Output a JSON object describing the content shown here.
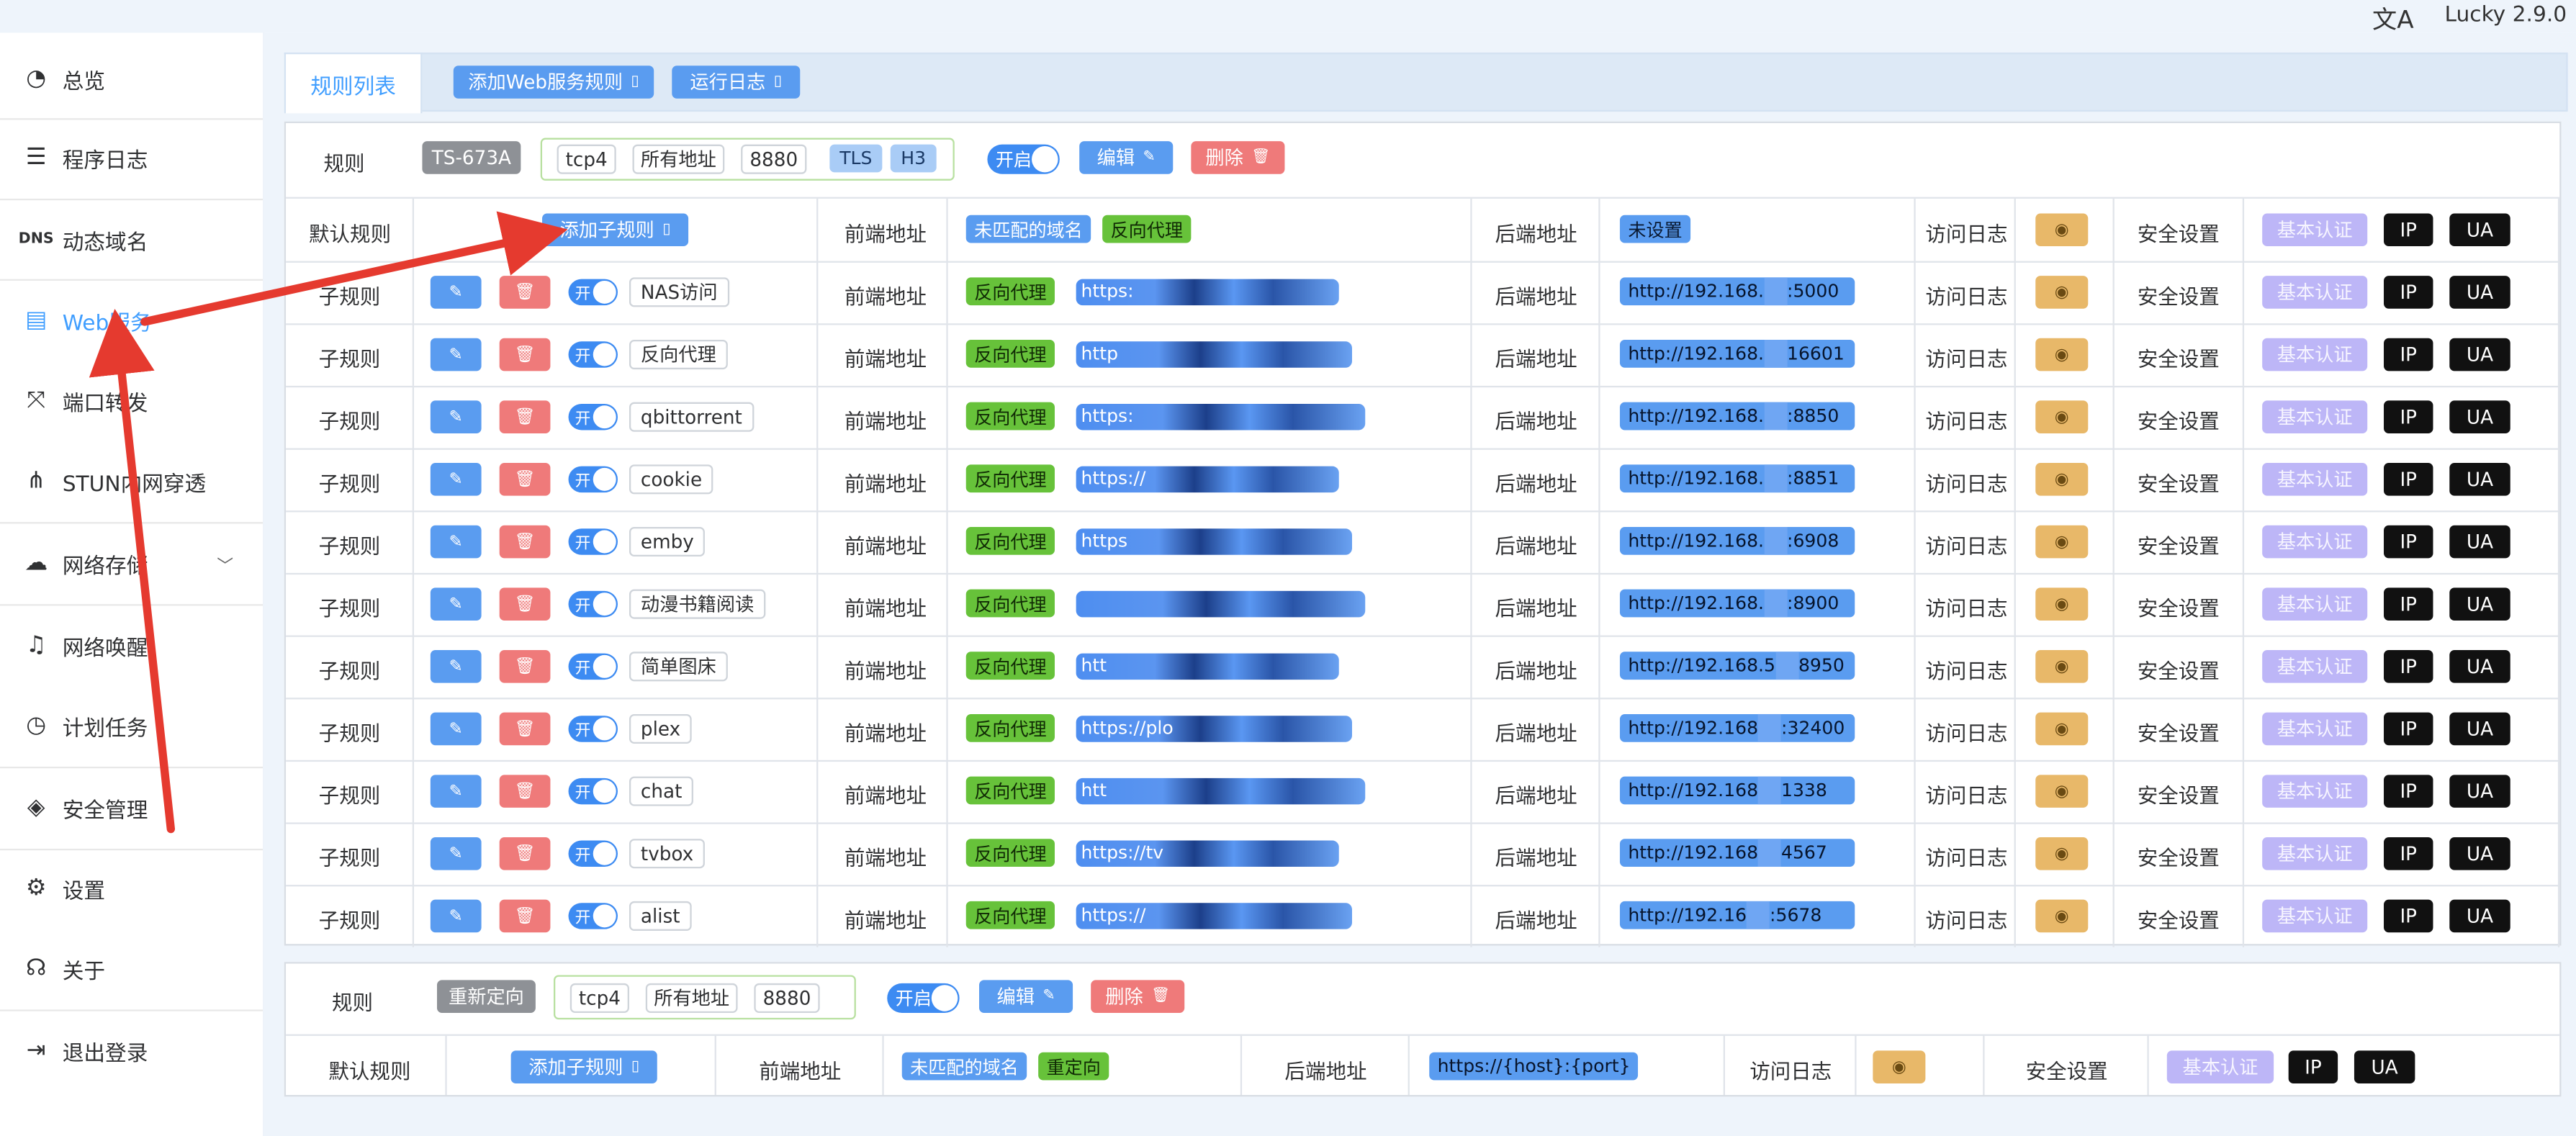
{
  "app": {
    "version": "Lucky 2.9.0",
    "lang_icon": "文A"
  },
  "sidebar": {
    "items": [
      {
        "label": "总览",
        "icon": "dashboard-icon"
      },
      {
        "label": "程序日志",
        "icon": "log-icon"
      },
      {
        "label": "动态域名",
        "icon": "dns-icon"
      },
      {
        "label": "Web服务",
        "icon": "web-service-icon"
      },
      {
        "label": "端口转发",
        "icon": "port-forward-icon"
      },
      {
        "label": "STUN内网穿透",
        "icon": "stun-icon"
      },
      {
        "label": "网络存储",
        "icon": "cloud-storage-icon"
      },
      {
        "label": "网络唤醒",
        "icon": "bell-icon"
      },
      {
        "label": "计划任务",
        "icon": "clock-icon"
      },
      {
        "label": "安全管理",
        "icon": "shield-icon"
      },
      {
        "label": "设置",
        "icon": "gear-icon"
      },
      {
        "label": "关于",
        "icon": "about-icon"
      },
      {
        "label": "退出登录",
        "icon": "logout-icon"
      }
    ],
    "active_index": 3
  },
  "tabs": {
    "rule_list": "规则列表",
    "add_web_rule": "添加Web服务规则",
    "run_log": "运行日志"
  },
  "common": {
    "rule": "规则",
    "default_rule": "默认规则",
    "sub_rule": "子规则",
    "add_sub_rule": "添加子规则",
    "frontend": "前端地址",
    "backend": "后端地址",
    "access_log": "访问日志",
    "security": "安全设置",
    "basic_auth": "基本认证",
    "ip": "IP",
    "ua": "UA",
    "enable": "开启",
    "on": "开",
    "edit": "编辑",
    "delete": "删除",
    "unmatched_domain": "未匹配的域名",
    "reverse_proxy": "反向代理",
    "redirect": "重定向",
    "not_set": "未设置"
  },
  "rule1": {
    "name": "TS-673A",
    "protocol": "tcp4",
    "address": "所有地址",
    "port": "8880",
    "tls": "TLS",
    "h3": "H3",
    "sub_rules": [
      {
        "name": "NAS访问",
        "frontend": "https:",
        "backend": "http://192.168.",
        "backend_tail": ":5000"
      },
      {
        "name": "反向代理",
        "frontend": "http",
        "backend": "http://192.168.",
        "backend_tail": "16601"
      },
      {
        "name": "qbittorrent",
        "frontend": "https:",
        "backend": "http://192.168.",
        "backend_tail": ":8850"
      },
      {
        "name": "cookie",
        "frontend": "https://",
        "backend": "http://192.168.",
        "backend_tail": ":8851"
      },
      {
        "name": "emby",
        "frontend": "https",
        "backend": "http://192.168.",
        "backend_tail": ":6908"
      },
      {
        "name": "动漫书籍阅读",
        "frontend": "",
        "backend": "http://192.168.",
        "backend_tail": ":8900"
      },
      {
        "name": "简单图床",
        "frontend": "htt",
        "backend": "http://192.168.5",
        "backend_tail": "8950"
      },
      {
        "name": "plex",
        "frontend": "https://plo",
        "backend": "http://192.168",
        "backend_tail": ":32400"
      },
      {
        "name": "chat",
        "frontend": "htt",
        "backend": "http://192.168",
        "backend_tail": "1338"
      },
      {
        "name": "tvbox",
        "frontend": "https://tv",
        "backend": "http://192.168",
        "backend_tail": "4567"
      },
      {
        "name": "alist",
        "frontend": "https://",
        "backend": "http://192.16",
        "backend_tail": ":5678"
      }
    ]
  },
  "rule2": {
    "name": "重新定向",
    "protocol": "tcp4",
    "address": "所有地址",
    "port": "8880",
    "backend": "https://{host}:{port}"
  }
}
